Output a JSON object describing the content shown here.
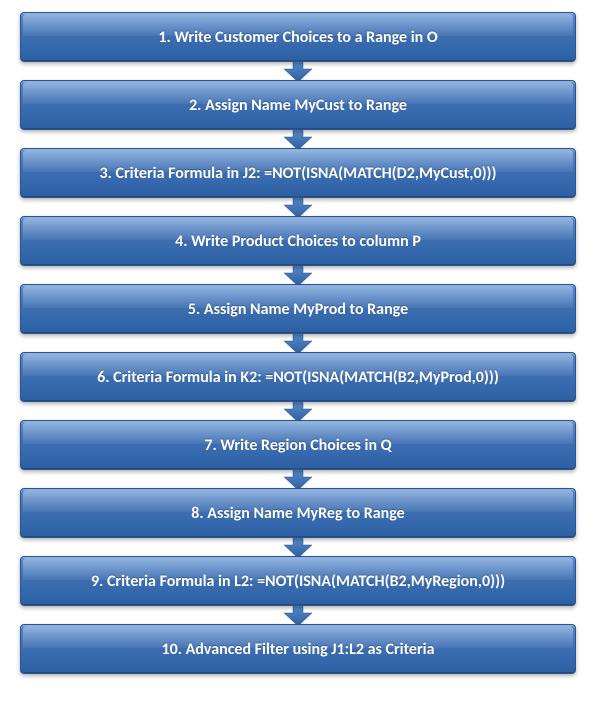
{
  "steps": [
    {
      "label": "1. Write Customer Choices to a Range in O"
    },
    {
      "label": "2. Assign Name MyCust to Range"
    },
    {
      "label": "3. Criteria Formula in J2: =NOT(ISNA(MATCH(D2,MyCust,0)))"
    },
    {
      "label": "4. Write Product Choices to column  P"
    },
    {
      "label": "5. Assign Name MyProd to Range"
    },
    {
      "label": "6. Criteria Formula in K2: =NOT(ISNA(MATCH(B2,MyProd,0)))"
    },
    {
      "label": "7. Write Region Choices  in Q"
    },
    {
      "label": "8. Assign Name MyReg to Range"
    },
    {
      "label": "9. Criteria Formula in L2: =NOT(ISNA(MATCH(B2,MyRegion,0)))"
    },
    {
      "label": "10. Advanced Filter using J1:L2 as Criteria"
    }
  ],
  "colors": {
    "box_fill_top": "#5b8fd0",
    "box_fill_bottom": "#2d5fa0",
    "arrow_fill": "#3a6db0",
    "text": "#ffffff"
  }
}
